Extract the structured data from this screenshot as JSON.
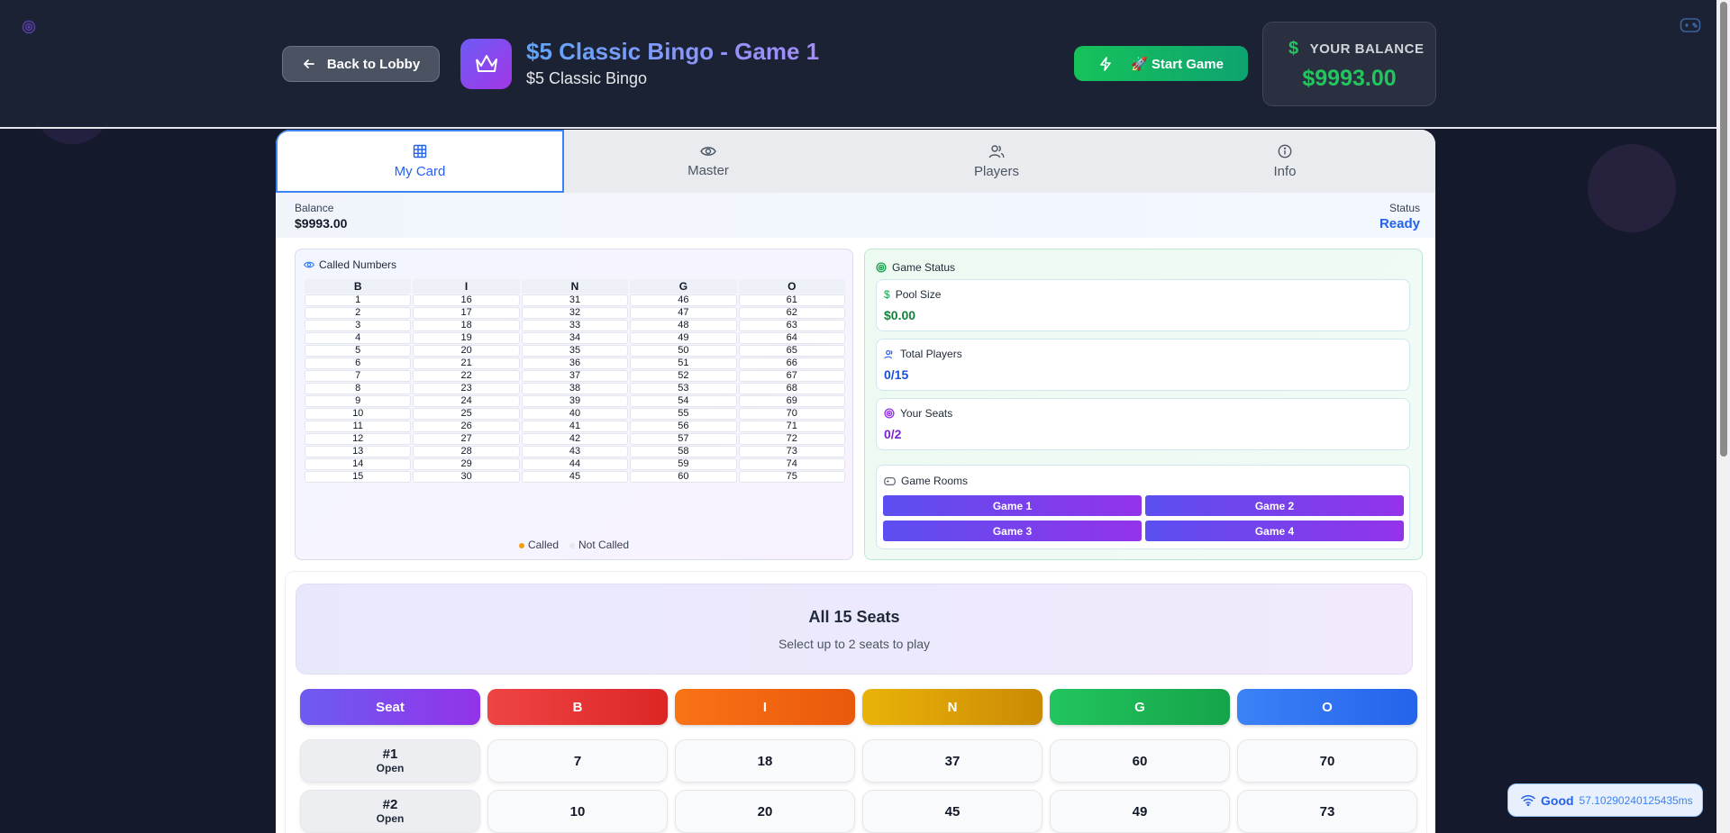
{
  "header": {
    "back_label": "Back to Lobby",
    "title": "$5 Classic Bingo - Game 1",
    "subtitle": "$5 Classic Bingo",
    "start_label": "🚀 Start Game",
    "balance_label": "YOUR BALANCE",
    "balance_value": "$9993.00"
  },
  "tabs": [
    {
      "label": "My Card",
      "icon": "grid-icon"
    },
    {
      "label": "Master",
      "icon": "eye-icon"
    },
    {
      "label": "Players",
      "icon": "users-icon"
    },
    {
      "label": "Info",
      "icon": "info-icon"
    }
  ],
  "status_row": {
    "balance_label": "Balance",
    "balance_value": "$9993.00",
    "status_label": "Status",
    "status_value": "Ready"
  },
  "called_numbers": {
    "title": "Called Numbers",
    "columns": [
      "B",
      "I",
      "N",
      "G",
      "O"
    ],
    "rows": [
      [
        "1",
        "16",
        "31",
        "46",
        "61"
      ],
      [
        "2",
        "17",
        "32",
        "47",
        "62"
      ],
      [
        "3",
        "18",
        "33",
        "48",
        "63"
      ],
      [
        "4",
        "19",
        "34",
        "49",
        "64"
      ],
      [
        "5",
        "20",
        "35",
        "50",
        "65"
      ],
      [
        "6",
        "21",
        "36",
        "51",
        "66"
      ],
      [
        "7",
        "22",
        "37",
        "52",
        "67"
      ],
      [
        "8",
        "23",
        "38",
        "53",
        "68"
      ],
      [
        "9",
        "24",
        "39",
        "54",
        "69"
      ],
      [
        "10",
        "25",
        "40",
        "55",
        "70"
      ],
      [
        "11",
        "26",
        "41",
        "56",
        "71"
      ],
      [
        "12",
        "27",
        "42",
        "57",
        "72"
      ],
      [
        "13",
        "28",
        "43",
        "58",
        "73"
      ],
      [
        "14",
        "29",
        "44",
        "59",
        "74"
      ],
      [
        "15",
        "30",
        "45",
        "60",
        "75"
      ]
    ],
    "legend_called": "Called",
    "legend_not_called": "Not Called"
  },
  "game_status": {
    "title": "Game Status",
    "pool_label": "Pool Size",
    "pool_value": "$0.00",
    "players_label": "Total Players",
    "players_value": "0/15",
    "seats_label": "Your Seats",
    "seats_value": "0/2",
    "rooms_label": "Game Rooms",
    "rooms": [
      "Game 1",
      "Game 2",
      "Game 3",
      "Game 4"
    ]
  },
  "seats": {
    "title": "All 15 Seats",
    "subtitle": "Select up to 2 seats to play",
    "headers": [
      "Seat",
      "B",
      "I",
      "N",
      "G",
      "O"
    ],
    "rows": [
      {
        "seat": "#1",
        "status": "Open",
        "numbers": [
          "7",
          "18",
          "37",
          "60",
          "70"
        ]
      },
      {
        "seat": "#2",
        "status": "Open",
        "numbers": [
          "10",
          "20",
          "45",
          "49",
          "73"
        ]
      }
    ]
  },
  "connection": {
    "quality": "Good",
    "latency": "57.10290240125435ms"
  },
  "colors": {
    "accent_blue": "#3b82f6",
    "success_green": "#22c55e",
    "purple": "#8b5cf6",
    "col_seat": "#7c4dee",
    "col_b": "#dc2626",
    "col_i": "#ea580c",
    "col_n": "#ca8a04",
    "col_g": "#16a34a",
    "col_o": "#2563eb"
  }
}
